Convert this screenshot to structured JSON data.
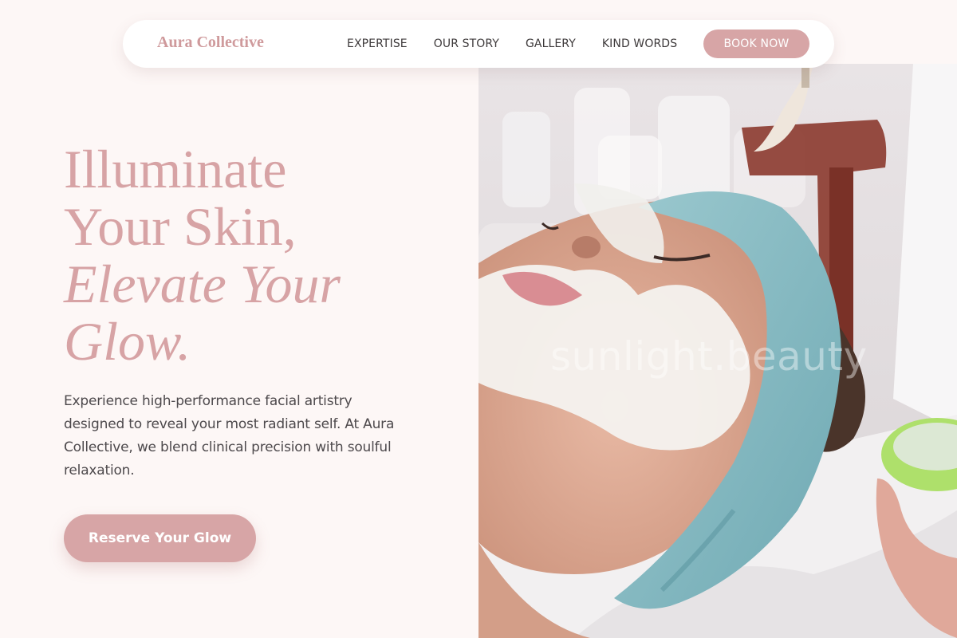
{
  "brand": {
    "name": "Aura Collective",
    "accent_color": "#d7a5a6",
    "logo_color": "#cf9a9c"
  },
  "nav": {
    "links": [
      "EXPERTISE",
      "OUR STORY",
      "GALLERY",
      "KIND WORDS"
    ],
    "cta_label": "BOOK NOW"
  },
  "hero": {
    "headline_lines": [
      "Illuminate",
      "Your Skin,"
    ],
    "headline_italic_lines": [
      "Elevate Your",
      "Glow."
    ],
    "body": "Experience high-performance facial artistry designed to reveal your most radiant self. At Aura Collective, we blend clinical precision with soulful relaxation.",
    "cta_label": "Reserve Your Glow"
  },
  "photo": {
    "subject": "woman receiving facial mask treatment",
    "watermark": "sunlight.beauty"
  },
  "colors": {
    "background": "#fdf7f6",
    "body_text": "#4d494c",
    "nav_text": "#3e3a3b",
    "headline": "#d7a3a5"
  }
}
